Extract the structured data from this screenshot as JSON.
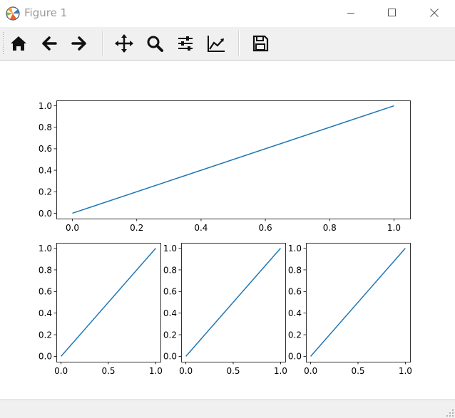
{
  "window": {
    "title": "Figure 1",
    "icon": "matplotlib-logo-icon",
    "controls": [
      "minimize-icon",
      "maximize-icon",
      "close-icon"
    ]
  },
  "toolbar": {
    "buttons": [
      {
        "name": "home-button",
        "icon": "home-icon"
      },
      {
        "name": "back-button",
        "icon": "arrow-left-icon"
      },
      {
        "name": "forward-button",
        "icon": "arrow-right-icon"
      },
      {
        "name": "pan-button",
        "icon": "move-icon"
      },
      {
        "name": "zoom-button",
        "icon": "magnifier-icon"
      },
      {
        "name": "subplots-button",
        "icon": "sliders-icon"
      },
      {
        "name": "edit-axes-button",
        "icon": "line-chart-icon"
      },
      {
        "name": "save-button",
        "icon": "floppy-disk-icon"
      }
    ]
  },
  "colors": {
    "line": "#1f77b4",
    "toolbar_bg": "#f0f0f0",
    "title_text": "#9a9a9a"
  },
  "chart_data": [
    {
      "type": "line",
      "position": "top",
      "series": [
        {
          "x": [
            0,
            1
          ],
          "y": [
            0,
            1
          ]
        }
      ],
      "xlim": [
        -0.05,
        1.05
      ],
      "ylim": [
        -0.05,
        1.05
      ],
      "xticks": [
        "0.0",
        "0.2",
        "0.4",
        "0.6",
        "0.8",
        "1.0"
      ],
      "yticks": [
        "0.0",
        "0.2",
        "0.4",
        "0.6",
        "0.8",
        "1.0"
      ],
      "title": "",
      "xlabel": "",
      "ylabel": "",
      "grid": false
    },
    {
      "type": "line",
      "position": "bottom-left",
      "series": [
        {
          "x": [
            0,
            1
          ],
          "y": [
            0,
            1
          ]
        }
      ],
      "xlim": [
        -0.05,
        1.05
      ],
      "ylim": [
        -0.05,
        1.05
      ],
      "xticks": [
        "0.0",
        "0.5",
        "1.0"
      ],
      "yticks": [
        "0.0",
        "0.2",
        "0.4",
        "0.6",
        "0.8",
        "1.0"
      ],
      "title": "",
      "xlabel": "",
      "ylabel": "",
      "grid": false
    },
    {
      "type": "line",
      "position": "bottom-center",
      "series": [
        {
          "x": [
            0,
            1
          ],
          "y": [
            0,
            1
          ]
        }
      ],
      "xlim": [
        -0.05,
        1.05
      ],
      "ylim": [
        -0.05,
        1.05
      ],
      "xticks": [
        "0.0",
        "0.5",
        "1.0"
      ],
      "yticks": [
        "0.0",
        "0.2",
        "0.4",
        "0.6",
        "0.8",
        "1.0"
      ],
      "title": "",
      "xlabel": "",
      "ylabel": "",
      "grid": false
    },
    {
      "type": "line",
      "position": "bottom-right",
      "series": [
        {
          "x": [
            0,
            1
          ],
          "y": [
            0,
            1
          ]
        }
      ],
      "xlim": [
        -0.05,
        1.05
      ],
      "ylim": [
        -0.05,
        1.05
      ],
      "xticks": [
        "0.0",
        "0.5",
        "1.0"
      ],
      "yticks": [
        "0.0",
        "0.2",
        "0.4",
        "0.6",
        "0.8",
        "1.0"
      ],
      "title": "",
      "xlabel": "",
      "ylabel": "",
      "grid": false
    }
  ]
}
